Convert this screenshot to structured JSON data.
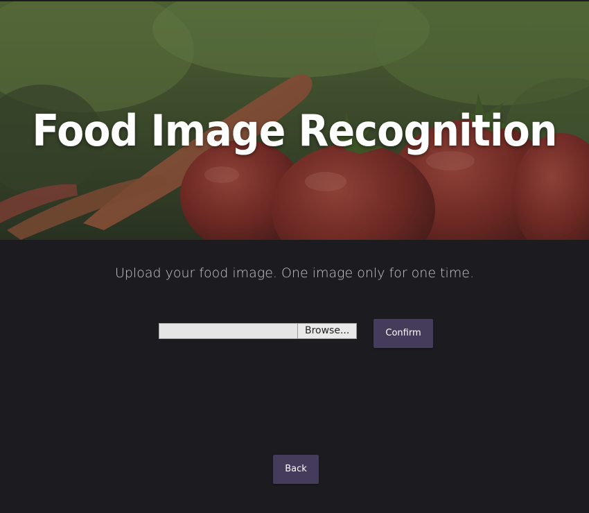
{
  "hero": {
    "title": "Food Image Recognition"
  },
  "upload": {
    "instructions": "Upload your food image. One image only for one time.",
    "file_value": "",
    "browse_label": "Browse...",
    "confirm_label": "Confirm"
  },
  "navigation": {
    "back_label": "Back"
  },
  "colors": {
    "page_background": "#1c1b20",
    "button_background": "#453b5b",
    "title_text": "#ffffff",
    "instruction_text": "#c9c8cc"
  }
}
